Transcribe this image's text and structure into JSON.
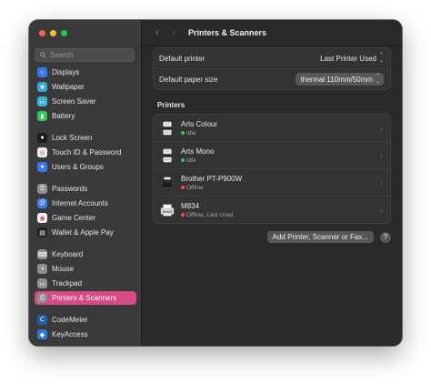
{
  "sidebar": {
    "search_placeholder": "Search",
    "items": [
      {
        "label": "Displays",
        "icon": "display-icon",
        "color": "#3478f6",
        "glyph": "☼"
      },
      {
        "label": "Wallpaper",
        "icon": "wallpaper-icon",
        "color": "#2fa8e0",
        "glyph": "❀"
      },
      {
        "label": "Screen Saver",
        "icon": "screen-saver-icon",
        "color": "#34b4d8",
        "glyph": "▭"
      },
      {
        "label": "Battery",
        "icon": "battery-icon",
        "color": "#34c759",
        "glyph": "▮"
      },
      {
        "label": "Lock Screen",
        "icon": "lock-icon",
        "color": "#1c1c1c",
        "glyph": "●"
      },
      {
        "label": "Touch ID & Password",
        "icon": "fingerprint-icon",
        "color": "#f2f2f2",
        "glyph": "◎"
      },
      {
        "label": "Users & Groups",
        "icon": "users-icon",
        "color": "#3478f6",
        "glyph": "●"
      },
      {
        "label": "Passwords",
        "icon": "key-icon",
        "color": "#8e8e93",
        "glyph": "⚿"
      },
      {
        "label": "Internet Accounts",
        "icon": "at-icon",
        "color": "#3478f6",
        "glyph": "@"
      },
      {
        "label": "Game Center",
        "icon": "game-center-icon",
        "color": "#f2f2f2",
        "glyph": "◉"
      },
      {
        "label": "Wallet & Apple Pay",
        "icon": "wallet-icon",
        "color": "#1f1f1f",
        "glyph": "▤"
      },
      {
        "label": "Keyboard",
        "icon": "keyboard-icon",
        "color": "#8e8e93",
        "glyph": "⌨"
      },
      {
        "label": "Mouse",
        "icon": "mouse-icon",
        "color": "#8e8e93",
        "glyph": "◖"
      },
      {
        "label": "Trackpad",
        "icon": "trackpad-icon",
        "color": "#8e8e93",
        "glyph": "▭"
      },
      {
        "label": "Printers & Scanners",
        "icon": "printer-icon",
        "color": "#8e8e93",
        "glyph": "⎙"
      },
      {
        "label": "CodeMeter",
        "icon": "codemeter-icon",
        "color": "#1f5fa8",
        "glyph": "C"
      },
      {
        "label": "KeyAccess",
        "icon": "keyaccess-icon",
        "color": "#2a7bd6",
        "glyph": "◆"
      }
    ]
  },
  "main": {
    "title": "Printers & Scanners",
    "settings": [
      {
        "label": "Default printer",
        "value": "Last Printer Used"
      },
      {
        "label": "Default paper size",
        "value": "thermal 110mm/50mm"
      }
    ],
    "printers_title": "Printers",
    "printers": [
      {
        "name": "Arts Colour",
        "status": "Idle",
        "status_color": "#34c759"
      },
      {
        "name": "Arts Mono",
        "status": "Idle",
        "status_color": "#34c759"
      },
      {
        "name": "Brother PT-P900W",
        "status": "Offline",
        "status_color": "#ff453a"
      },
      {
        "name": "M834",
        "status": "Offline, Last Used",
        "status_color": "#ff453a"
      }
    ],
    "add_button": "Add Printer, Scanner or Fax...",
    "help": "?"
  }
}
